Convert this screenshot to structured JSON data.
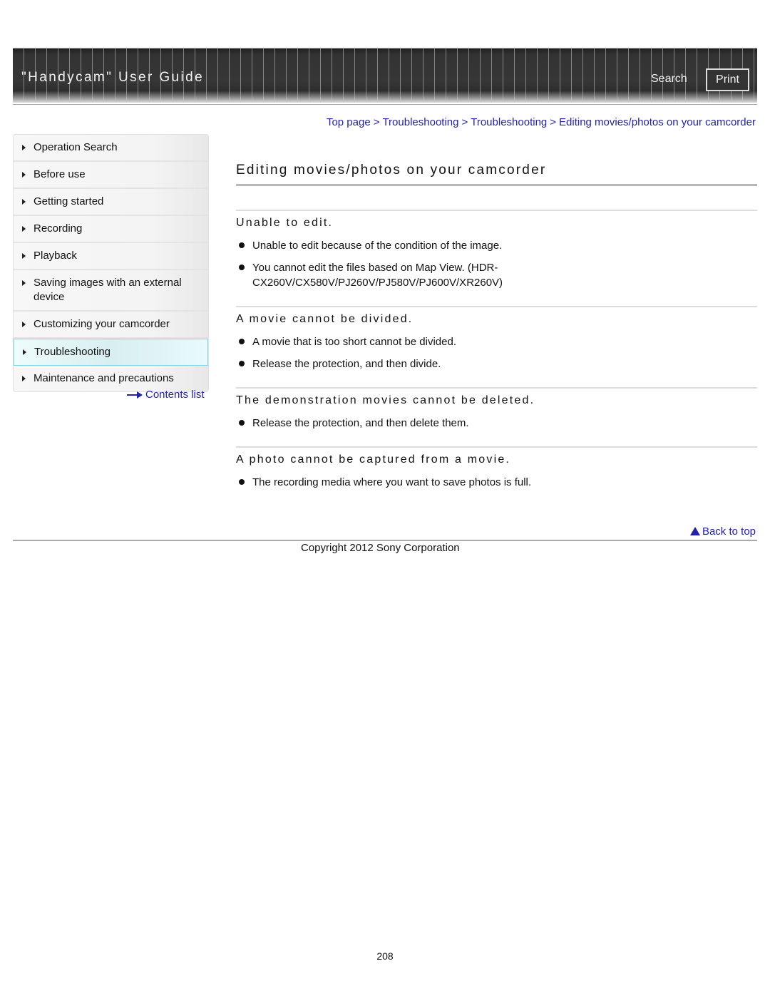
{
  "header": {
    "title": "\"Handycam\" User Guide",
    "search_label": "Search",
    "print_label": "Print"
  },
  "breadcrumb": [
    {
      "label": "Top page"
    },
    {
      "label": "Troubleshooting"
    },
    {
      "label": "Troubleshooting"
    },
    {
      "label": "Editing movies/photos on your camcorder"
    }
  ],
  "breadcrumb_separator": ">",
  "sidebar": {
    "items": [
      {
        "label": "Operation Search"
      },
      {
        "label": "Before use"
      },
      {
        "label": "Getting started"
      },
      {
        "label": "Recording"
      },
      {
        "label": "Playback"
      },
      {
        "label": "Saving images with an external device"
      },
      {
        "label": "Customizing your camcorder"
      },
      {
        "label": "Troubleshooting",
        "active": true
      },
      {
        "label": "Maintenance and precautions"
      }
    ],
    "contents_link": "Contents list"
  },
  "main": {
    "title": "Editing movies/photos on your camcorder",
    "sections": [
      {
        "title": "Unable to edit.",
        "bullets": [
          "Unable to edit because of the condition of the image.",
          "You cannot edit the files based on Map View. (HDR-CX260V/CX580V/PJ260V/PJ580V/PJ600V/XR260V)"
        ]
      },
      {
        "title": "A movie cannot be divided.",
        "bullets": [
          "A movie that is too short cannot be divided.",
          "Release the protection, and then divide."
        ]
      },
      {
        "title": "The demonstration movies cannot be deleted.",
        "bullets": [
          "Release the protection, and then delete them."
        ]
      },
      {
        "title": "A photo cannot be captured from a movie.",
        "bullets": [
          "The recording media where you want to save photos is full."
        ]
      }
    ],
    "back_to_top": "Back to top"
  },
  "footer": {
    "copyright": "Copyright 2012 Sony Corporation",
    "page_number": "208"
  },
  "colors": {
    "link": "#2222aa",
    "header_bg": "#333333",
    "active_nav_border": "#7fd8ea"
  }
}
